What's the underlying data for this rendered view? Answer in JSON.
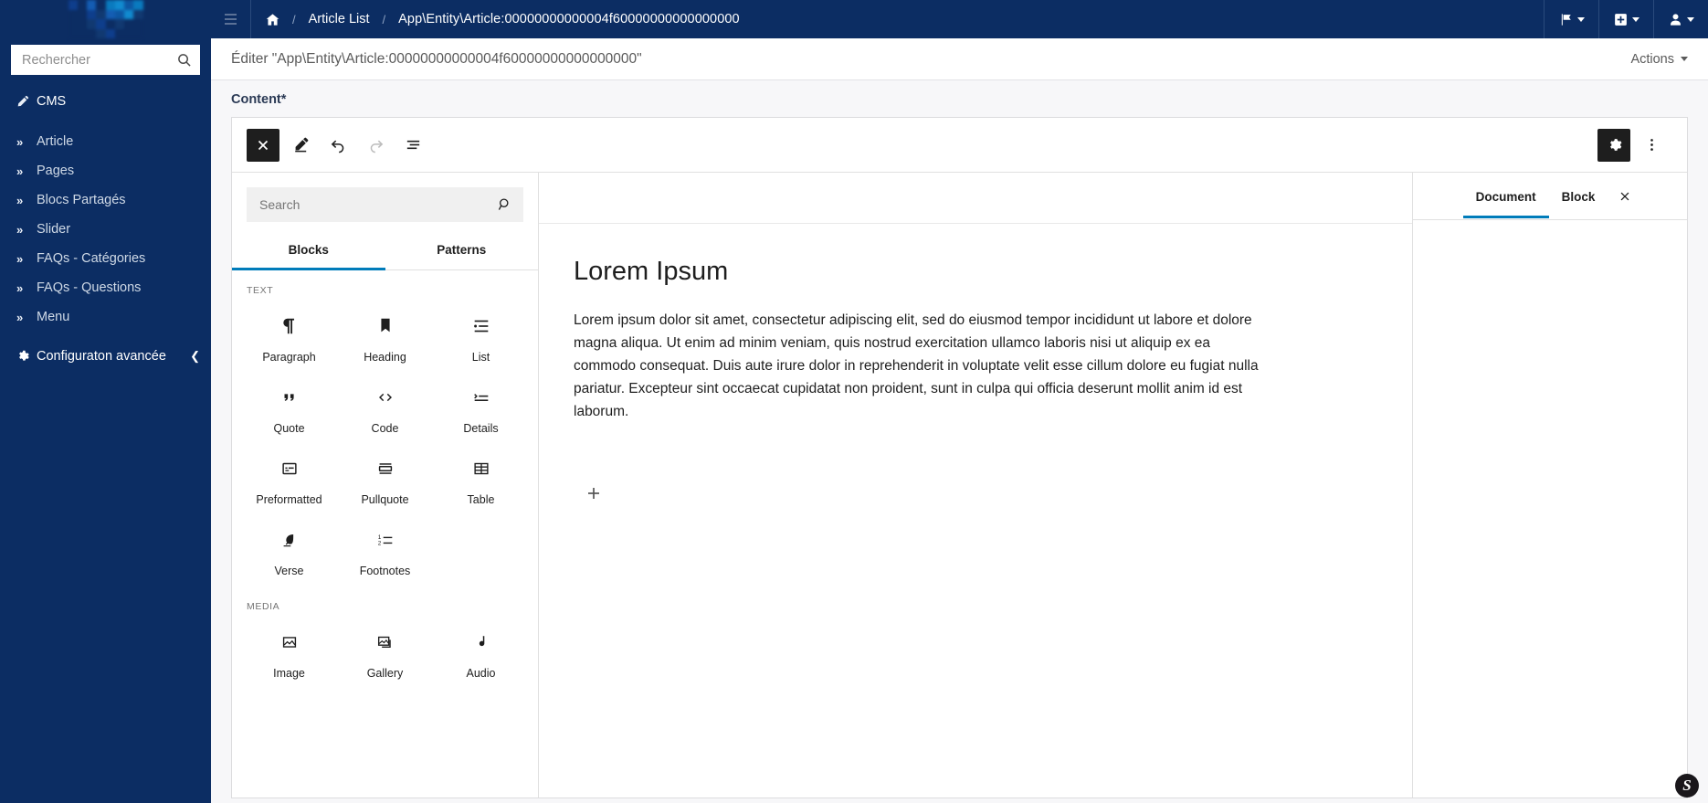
{
  "sidebar": {
    "brand_name": "logo-image",
    "search": {
      "placeholder": "Rechercher",
      "value": "",
      "icon": "search-icon"
    },
    "section": {
      "label": "CMS",
      "icon": "pencil-icon"
    },
    "items": [
      {
        "label": "Article",
        "icon": "chevrons-right-icon"
      },
      {
        "label": "Pages",
        "icon": "chevrons-right-icon"
      },
      {
        "label": "Blocs Partagés",
        "icon": "chevrons-right-icon"
      },
      {
        "label": "Slider",
        "icon": "chevrons-right-icon"
      },
      {
        "label": "FAQs - Catégories",
        "icon": "chevrons-right-icon"
      },
      {
        "label": "FAQs - Questions",
        "icon": "chevrons-right-icon"
      },
      {
        "label": "Menu",
        "icon": "chevrons-right-icon"
      }
    ],
    "bottom": {
      "label": "Configuraton avancée",
      "icon": "gear-icon",
      "collapse_icon": "chevron-left-icon"
    },
    "bg_color": "#0c2d63"
  },
  "topbar": {
    "menu_icon": "hamburger-icon",
    "breadcrumb": {
      "home_icon": "home-icon",
      "separator": "/",
      "list_label": "Article List",
      "entity_label": "App\\Entity\\Article:00000000000004f60000000000000000"
    },
    "actions": [
      {
        "name": "locale-switcher",
        "icon": "flag-icon"
      },
      {
        "name": "new-entity",
        "icon": "plus-square-icon"
      },
      {
        "name": "user-menu",
        "icon": "user-icon"
      }
    ]
  },
  "pagehead": {
    "title": "Éditer \"App\\Entity\\Article:00000000000004f60000000000000000\"",
    "actions_label": "Actions",
    "actions_icon": "caret-down-icon"
  },
  "form": {
    "field_label": "Content*"
  },
  "editor": {
    "toolbar": {
      "close_label": "×",
      "close_icon": "close-x-icon",
      "edit_icon": "pencil-icon",
      "undo_icon": "undo-arrow-icon",
      "redo_icon": "redo-arrow-icon",
      "listview_icon": "list-view-icon",
      "settings_icon": "gear-icon",
      "more_icon": "kebab-menu-icon"
    },
    "inserter": {
      "search": {
        "placeholder": "Search",
        "value": "",
        "icon": "search-icon"
      },
      "tabs": [
        {
          "label": "Blocks",
          "active": true
        },
        {
          "label": "Patterns",
          "active": false
        }
      ],
      "categories": [
        {
          "name": "TEXT",
          "blocks": [
            {
              "label": "Paragraph",
              "icon": "pilcrow-icon"
            },
            {
              "label": "Heading",
              "icon": "bookmark-icon"
            },
            {
              "label": "List",
              "icon": "bullet-list-icon"
            },
            {
              "label": "Quote",
              "icon": "quote-marks-icon"
            },
            {
              "label": "Code",
              "icon": "angle-brackets-icon"
            },
            {
              "label": "Details",
              "icon": "details-disclosure-icon"
            },
            {
              "label": "Preformatted",
              "icon": "preformatted-box-icon"
            },
            {
              "label": "Pullquote",
              "icon": "pullquote-icon"
            },
            {
              "label": "Table",
              "icon": "table-grid-icon"
            },
            {
              "label": "Verse",
              "icon": "feather-pen-icon"
            },
            {
              "label": "Footnotes",
              "icon": "numbered-list-icon"
            }
          ]
        },
        {
          "name": "MEDIA",
          "blocks": [
            {
              "label": "Image",
              "icon": "image-icon"
            },
            {
              "label": "Gallery",
              "icon": "gallery-icon"
            },
            {
              "label": "Audio",
              "icon": "music-note-icon"
            }
          ]
        }
      ]
    },
    "canvas": {
      "title": "Lorem Ipsum",
      "paragraph": "Lorem ipsum dolor sit amet, consectetur adipiscing elit, sed do eiusmod tempor incididunt ut labore et dolore magna aliqua. Ut enim ad minim veniam, quis nostrud exercitation ullamco laboris nisi ut aliquip ex ea commodo consequat. Duis aute irure dolor in reprehenderit in voluptate velit esse cillum dolore eu fugiat nulla pariatur. Excepteur sint occaecat cupidatat non proident, sunt in culpa qui officia deserunt mollit anim id est laborum.",
      "appender_label": "+",
      "appender_icon": "plus-icon"
    },
    "settings_panel": {
      "tabs": [
        {
          "label": "Document",
          "active": true
        },
        {
          "label": "Block",
          "active": false
        }
      ],
      "close_icon": "close-x-icon"
    }
  },
  "footer": {
    "symfony_badge": "S"
  },
  "colors": {
    "accent": "#007cba",
    "brand": "#0c2d63",
    "dark_button": "#1e1e1e"
  }
}
